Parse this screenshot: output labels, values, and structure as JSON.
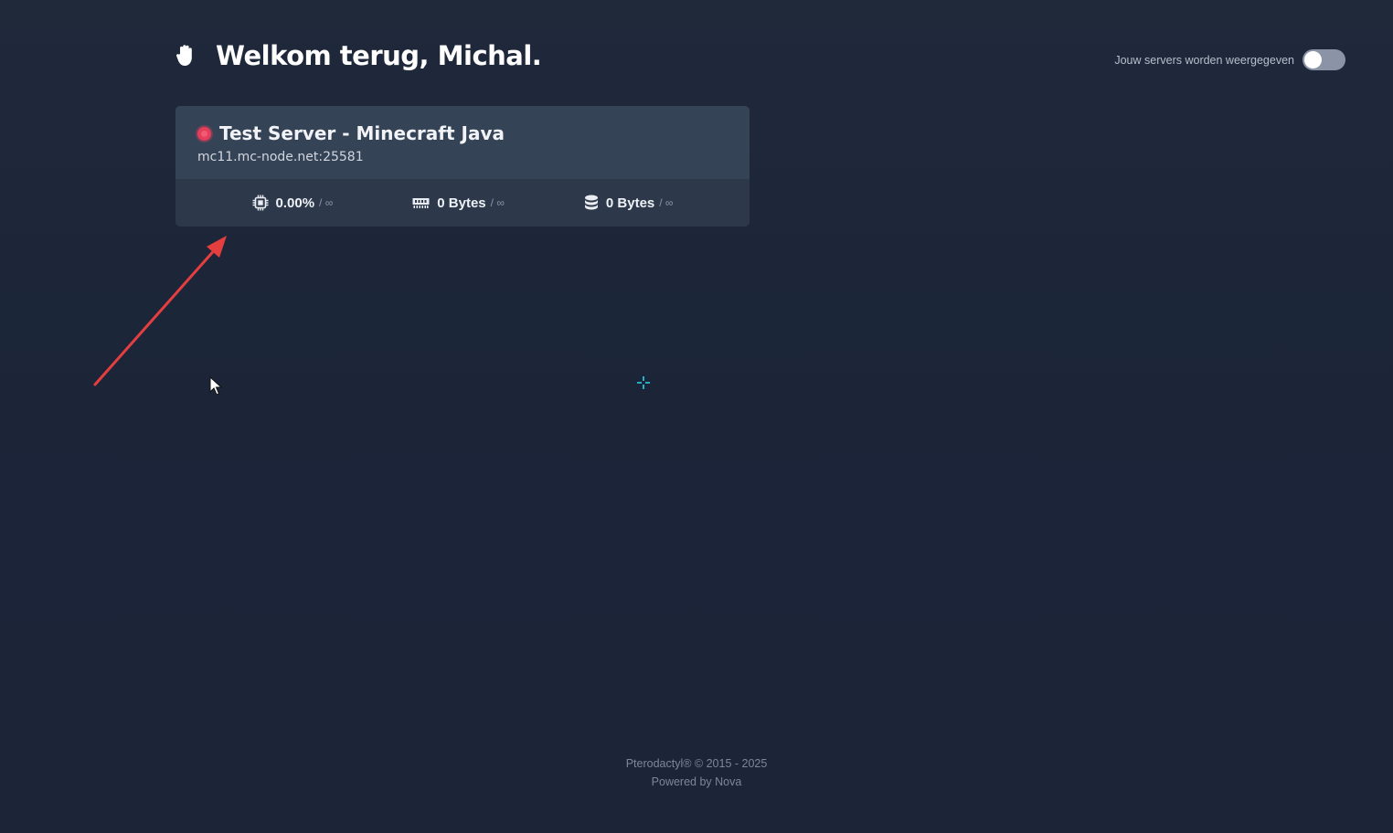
{
  "header": {
    "greeting": "Welkom terug, Michal.",
    "toggle_label": "Jouw servers worden weergegeven",
    "toggle_on": false
  },
  "server": {
    "name": "Test Server - Minecraft Java",
    "address": "mc11.mc-node.net:25581",
    "status_color": "#e53e5b",
    "stats": {
      "cpu": {
        "value": "0.00%",
        "limit": "/ ∞"
      },
      "memory": {
        "value": "0 Bytes",
        "limit": "/ ∞"
      },
      "disk": {
        "value": "0 Bytes",
        "limit": "/ ∞"
      }
    }
  },
  "footer": {
    "copyright": "Pterodactyl® © 2015 - 2025",
    "powered_by": "Powered by Nova"
  },
  "annotation": {
    "arrow_color": "#e53e3e"
  }
}
